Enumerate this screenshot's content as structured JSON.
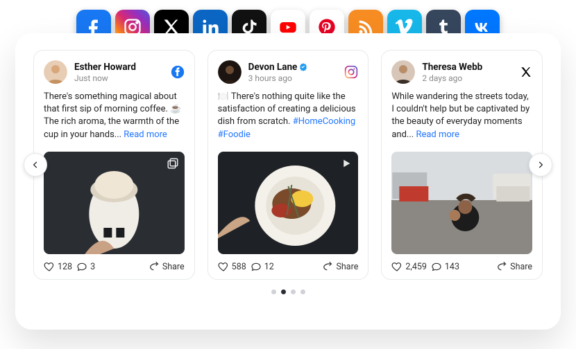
{
  "topIcons": [
    {
      "name": "facebook"
    },
    {
      "name": "instagram"
    },
    {
      "name": "x"
    },
    {
      "name": "linkedin"
    },
    {
      "name": "tiktok"
    },
    {
      "name": "youtube"
    },
    {
      "name": "pinterest"
    },
    {
      "name": "rss"
    },
    {
      "name": "vimeo"
    },
    {
      "name": "tumblr"
    },
    {
      "name": "vk"
    }
  ],
  "posts": [
    {
      "author": "Esther Howard",
      "time": "Just now",
      "verified": false,
      "network": "facebook",
      "text": "There's something magical about that first sip of morning coffee. ☕ The rich aroma, the warmth of the cup in your hands...",
      "readmore": "Read more",
      "likes": "128",
      "comments": "3",
      "share": "Share",
      "mediaBadge": "gallery"
    },
    {
      "author": "Devon Lane",
      "time": "3 hours ago",
      "verified": true,
      "network": "instagram",
      "text": "🍽️ There's nothing quite like the satisfaction of creating a delicious dish from scratch. ",
      "hashtags": "#HomeCooking #Foodie",
      "readmore": "",
      "likes": "588",
      "comments": "12",
      "share": "Share",
      "mediaBadge": "video"
    },
    {
      "author": "Theresa Webb",
      "time": "2 days ago",
      "verified": false,
      "network": "x",
      "text": "While wandering the streets today, I couldn't help but be captivated by the beauty of everyday moments and...",
      "readmore": "Read more",
      "likes": "2,459",
      "comments": "143",
      "share": "Share",
      "mediaBadge": ""
    }
  ],
  "carousel": {
    "count": 4,
    "active": 1
  }
}
